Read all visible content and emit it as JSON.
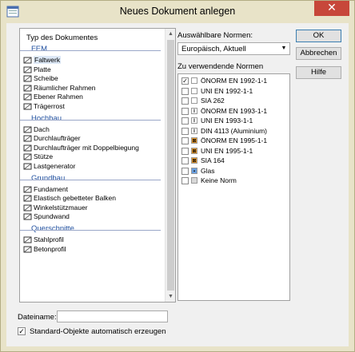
{
  "window": {
    "title": "Neues Dokument anlegen",
    "close_glyph": "✕"
  },
  "left_panel": {
    "header": "Typ des Dokumentes",
    "categories": [
      {
        "label": "FEM",
        "items": [
          {
            "label": "Faltwerk",
            "icon": "faltwerk-icon",
            "selected": true
          },
          {
            "label": "Platte",
            "icon": "platte-icon"
          },
          {
            "label": "Scheibe",
            "icon": "scheibe-icon"
          },
          {
            "label": "Räumlicher Rahmen",
            "icon": "raeumlicher-rahmen-icon"
          },
          {
            "label": "Ebener Rahmen",
            "icon": "ebener-rahmen-icon"
          },
          {
            "label": "Trägerrost",
            "icon": "traegerrost-icon"
          }
        ]
      },
      {
        "label": "Hochbau",
        "items": [
          {
            "label": "Dach",
            "icon": "dach-icon"
          },
          {
            "label": "Durchlaufträger",
            "icon": "durchlauftraeger-icon"
          },
          {
            "label": "Durchlaufträger mit Doppelbiegung",
            "icon": "durchlauftraeger-doppelbiegung-icon"
          },
          {
            "label": "Stütze",
            "icon": "stuetze-icon"
          },
          {
            "label": "Lastgenerator",
            "icon": "lastgenerator-icon"
          }
        ]
      },
      {
        "label": "Grundbau",
        "items": [
          {
            "label": "Fundament",
            "icon": "fundament-icon"
          },
          {
            "label": "Elastisch gebetteter Balken",
            "icon": "elastisch-gebetteter-balken-icon"
          },
          {
            "label": "Winkelstützmauer",
            "icon": "winkelstuetzmauer-icon"
          },
          {
            "label": "Spundwand",
            "icon": "spundwand-icon"
          }
        ]
      },
      {
        "label": "Querschnitte",
        "items": [
          {
            "label": "Stahlprofil",
            "icon": "stahlprofil-icon"
          },
          {
            "label": "Betonprofil",
            "icon": "betonprofil-icon"
          }
        ]
      }
    ]
  },
  "norms": {
    "available_label": "Auswählbare Normen:",
    "selected_value": "Europäisch, Aktuell",
    "used_label": "Zu verwendende Normen",
    "items": [
      {
        "label": "ÖNORM EN 1992-1-1",
        "checked": true,
        "icon": "concrete-icon",
        "mark": "",
        "color": "#ffffff"
      },
      {
        "label": "UNI EN 1992-1-1",
        "checked": false,
        "icon": "concrete-icon",
        "mark": "",
        "color": "#ffffff"
      },
      {
        "label": "SIA 262",
        "checked": false,
        "icon": "concrete-icon",
        "mark": "",
        "color": "#ffffff"
      },
      {
        "label": "ÖNORM EN 1993-1-1",
        "checked": false,
        "icon": "steel-icon",
        "mark": "I",
        "color": "#ffffff"
      },
      {
        "label": "UNI EN 1993-1-1",
        "checked": false,
        "icon": "steel-icon",
        "mark": "I",
        "color": "#ffffff"
      },
      {
        "label": "DIN 4113 (Aluminium)",
        "checked": false,
        "icon": "aluminium-icon",
        "mark": "I",
        "color": "#ffffff"
      },
      {
        "label": "ÖNORM EN 1995-1-1",
        "checked": false,
        "icon": "timber-icon",
        "mark": "⊠",
        "color": "#f0a030"
      },
      {
        "label": "UNI EN 1995-1-1",
        "checked": false,
        "icon": "timber-icon",
        "mark": "⊠",
        "color": "#f0a030"
      },
      {
        "label": "SIA 164",
        "checked": false,
        "icon": "timber-icon",
        "mark": "⊠",
        "color": "#f0a030"
      },
      {
        "label": "Glas",
        "checked": false,
        "icon": "glass-icon",
        "mark": "▪",
        "color": "#6aa0e0"
      },
      {
        "label": "Keine Norm",
        "checked": false,
        "icon": "none-icon",
        "mark": "",
        "color": "#d8d8d8"
      }
    ]
  },
  "buttons": {
    "ok": "OK",
    "cancel": "Abbrechen",
    "help": "Hilfe"
  },
  "footer": {
    "filename_label": "Dateiname:",
    "filename_value": "",
    "auto_objects_label": "Standard-Objekte automatisch erzeugen",
    "auto_objects_checked": true
  },
  "colors": {
    "window_border": "#e8e3c8",
    "category": "#1f4f9f",
    "close": "#c7473a"
  }
}
